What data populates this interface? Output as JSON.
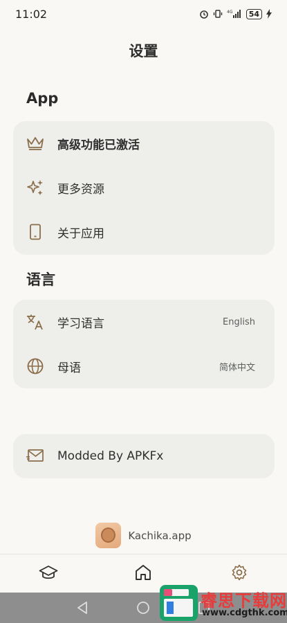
{
  "status_bar": {
    "time": "11:02",
    "battery": "54"
  },
  "header": {
    "title": "设置"
  },
  "sections": {
    "app": {
      "title": "App",
      "items": [
        {
          "label": "高级功能已激活",
          "icon": "crown-icon"
        },
        {
          "label": "更多资源",
          "icon": "sparkles-icon"
        },
        {
          "label": "关于应用",
          "icon": "phone-icon"
        }
      ]
    },
    "language": {
      "title": "语言",
      "items": [
        {
          "label": "学习语言",
          "value": "English",
          "icon": "translate-icon"
        },
        {
          "label": "母语",
          "value": "简体中文",
          "icon": "globe-icon"
        }
      ]
    },
    "mod": {
      "label": "Modded By APKFx",
      "icon": "mail-icon"
    }
  },
  "footer": {
    "brand": "Kachika.app"
  },
  "bottom_nav": [
    {
      "name": "learn",
      "icon": "graduation-cap-icon"
    },
    {
      "name": "home",
      "icon": "home-icon"
    },
    {
      "name": "settings",
      "icon": "gear-icon"
    }
  ],
  "watermark": {
    "title": "睿思下载网",
    "url": "www.cdgthk.com"
  },
  "colors": {
    "accent": "#8a6d4a",
    "background": "#f9f8f4",
    "card": "#eeeeea"
  }
}
